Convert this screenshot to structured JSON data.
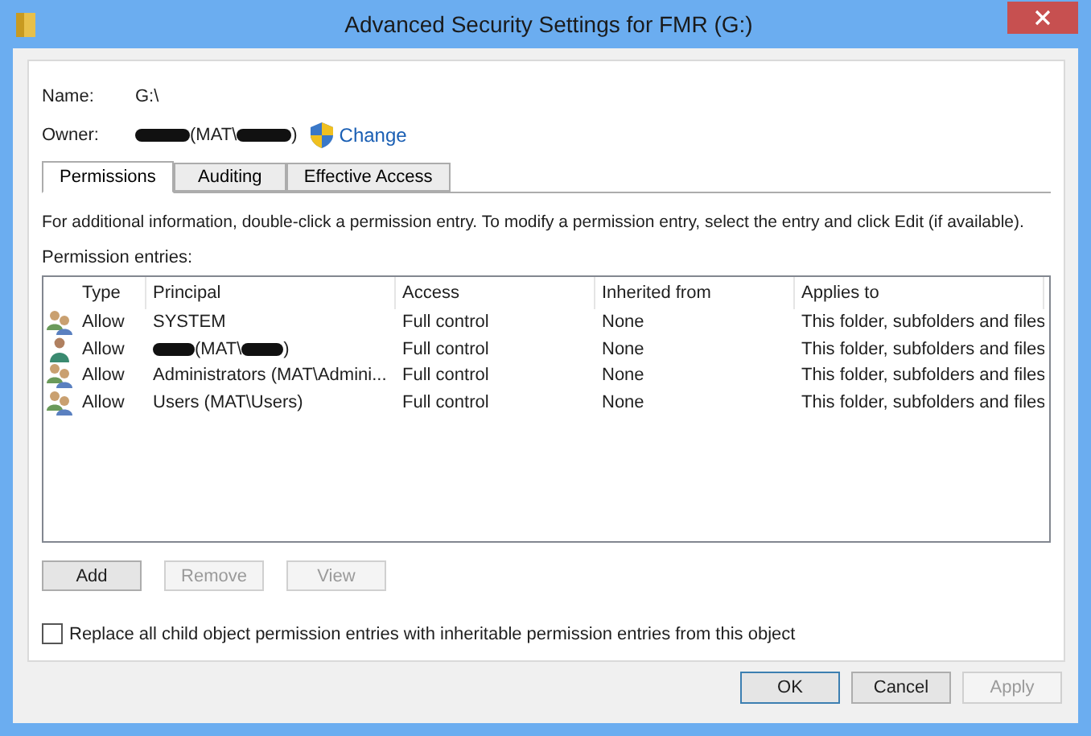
{
  "window": {
    "title": "Advanced Security Settings for FMR (G:)"
  },
  "name": {
    "label": "Name:",
    "value": "G:\\"
  },
  "owner": {
    "label": "Owner:",
    "value": [
      {
        "kind": "redacted"
      },
      {
        "kind": "text",
        "text": "(MAT\\"
      },
      {
        "kind": "redacted"
      },
      {
        "kind": "text",
        "text": ")"
      }
    ],
    "change_link": "Change"
  },
  "tabs": [
    {
      "label": "Permissions",
      "selected": true
    },
    {
      "label": "Auditing",
      "selected": false
    },
    {
      "label": "Effective Access",
      "selected": false
    }
  ],
  "info_text": "For additional information, double-click a permission entry. To modify a permission entry, select the entry and click Edit (if available).",
  "entries_label": "Permission entries:",
  "table": {
    "columns": [
      "Type",
      "Principal",
      "Access",
      "Inherited from",
      "Applies to"
    ],
    "rows": [
      {
        "kind": "group",
        "type": "Allow",
        "principal": [
          {
            "kind": "text",
            "text": "SYSTEM"
          }
        ],
        "access": "Full control",
        "inherited_from": "None",
        "applies_to": "This folder, subfolders and files"
      },
      {
        "kind": "user",
        "type": "Allow",
        "principal": [
          {
            "kind": "redacted"
          },
          {
            "kind": "text",
            "text": " (MAT\\"
          },
          {
            "kind": "redacted"
          },
          {
            "kind": "text",
            "text": ")"
          }
        ],
        "access": "Full control",
        "inherited_from": "None",
        "applies_to": "This folder, subfolders and files"
      },
      {
        "kind": "group",
        "type": "Allow",
        "principal": [
          {
            "kind": "text",
            "text": "Administrators (MAT\\Admini..."
          }
        ],
        "access": "Full control",
        "inherited_from": "None",
        "applies_to": "This folder, subfolders and files"
      },
      {
        "kind": "group",
        "type": "Allow",
        "principal": [
          {
            "kind": "text",
            "text": "Users (MAT\\Users)"
          }
        ],
        "access": "Full control",
        "inherited_from": "None",
        "applies_to": "This folder, subfolders and files"
      }
    ]
  },
  "entry_buttons": [
    {
      "label": "Add",
      "disabled": false
    },
    {
      "label": "Remove",
      "disabled": true
    },
    {
      "label": "View",
      "disabled": true
    }
  ],
  "replace_checkbox": {
    "label": "Replace all child object permission entries with inheritable permission entries from this object",
    "checked": false
  },
  "dialog_buttons": [
    {
      "label": "OK",
      "disabled": false,
      "focused": true
    },
    {
      "label": "Cancel",
      "disabled": false,
      "focused": false
    },
    {
      "label": "Apply",
      "disabled": true,
      "focused": false
    }
  ]
}
